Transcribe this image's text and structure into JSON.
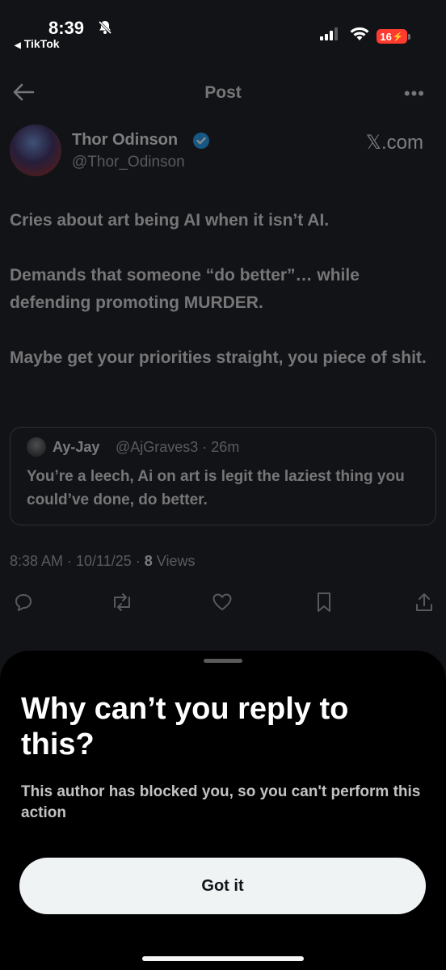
{
  "status_bar": {
    "time": "8:39",
    "back_app": "TikTok",
    "battery": "16"
  },
  "nav": {
    "title": "Post",
    "more": "•••"
  },
  "post": {
    "author_name": "Thor Odinson",
    "handle": "@Thor_Odinson",
    "source": "𝕏.com",
    "paragraphs": [
      "Cries about art being AI when it isn’t AI.",
      "Demands that someone “do better”… while defending promoting MURDER.",
      "Maybe get your priorities straight, you piece of shit."
    ],
    "quote": {
      "name": "Ay-Jay",
      "meta": "@AjGraves3 · 26m",
      "text": "You’re a leech, Ai on art is legit the laziest thing you could’ve done, do better."
    },
    "timestamp": "8:38 AM · 10/11/25 · ",
    "views_count": "8",
    "views_label": " Views"
  },
  "sheet": {
    "title": "Why can’t you reply to this?",
    "body": "This author has blocked you, so you can't perform this action",
    "button_label": "Got it"
  },
  "colors": {
    "background": "#121316",
    "sheet": "#000000",
    "button": "#eff3f4",
    "verified": "#1d9bf0",
    "battery": "#ff3b30"
  }
}
